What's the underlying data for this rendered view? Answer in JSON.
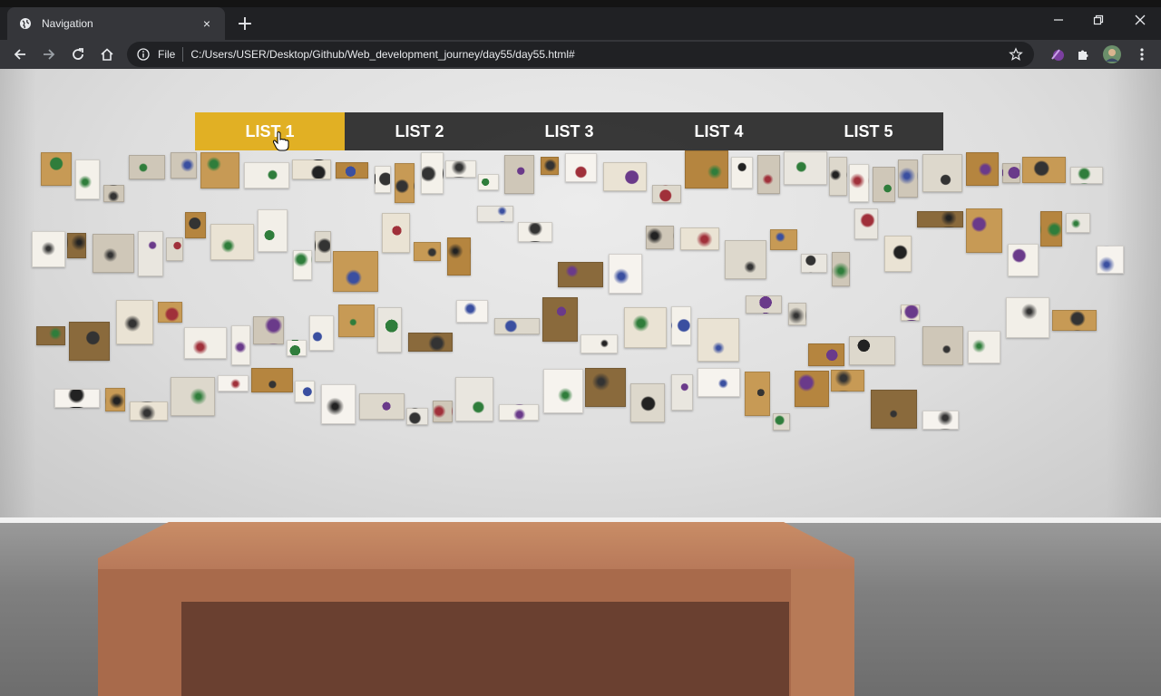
{
  "browser": {
    "tab_title": "Navigation",
    "tab_close": "×",
    "new_tab": "+",
    "scheme_label": "File",
    "url": "C:/Users/USER/Desktop/Github/Web_development_journey/day55/day55.html#"
  },
  "nav": {
    "items": [
      {
        "label": "LIST 1",
        "active": true
      },
      {
        "label": "LIST 2",
        "active": false
      },
      {
        "label": "LIST 3",
        "active": false
      },
      {
        "label": "LIST 4",
        "active": false
      },
      {
        "label": "LIST 5",
        "active": false
      }
    ],
    "active_color": "#e1b024",
    "bar_color": "#2b2b2b"
  },
  "icons": [
    "globe-icon",
    "close-icon",
    "plus-icon",
    "minimize-icon",
    "restore-icon",
    "window-close-icon",
    "back-icon",
    "forward-icon",
    "reload-icon",
    "home-icon",
    "info-icon",
    "star-icon",
    "extension-icon",
    "puzzle-icon",
    "profile-icon",
    "menu-icon",
    "pointer-cursor-icon"
  ]
}
